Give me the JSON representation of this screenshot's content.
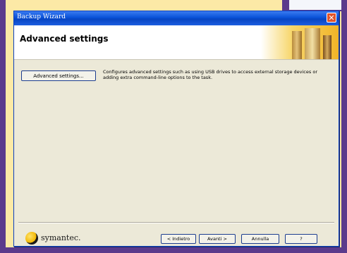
{
  "window": {
    "title": "Backup Wizard",
    "close_symbol": "✕"
  },
  "header": {
    "title": "Advanced settings"
  },
  "content": {
    "advanced_button_label": "Advanced settings...",
    "description": "Configures advanced settings such as using USB drives to access external storage devices or adding extra command-line options to the task."
  },
  "footer": {
    "brand": "symantec.",
    "buttons": {
      "back": "< Indietro",
      "next": "Avanti >",
      "cancel": "Annulla",
      "help": "?"
    }
  },
  "colors": {
    "titlebar": "#0a52d8",
    "dialog_bg": "#ece9d8",
    "page_bg": "#fce9a6",
    "frame": "#5b3a8c"
  }
}
